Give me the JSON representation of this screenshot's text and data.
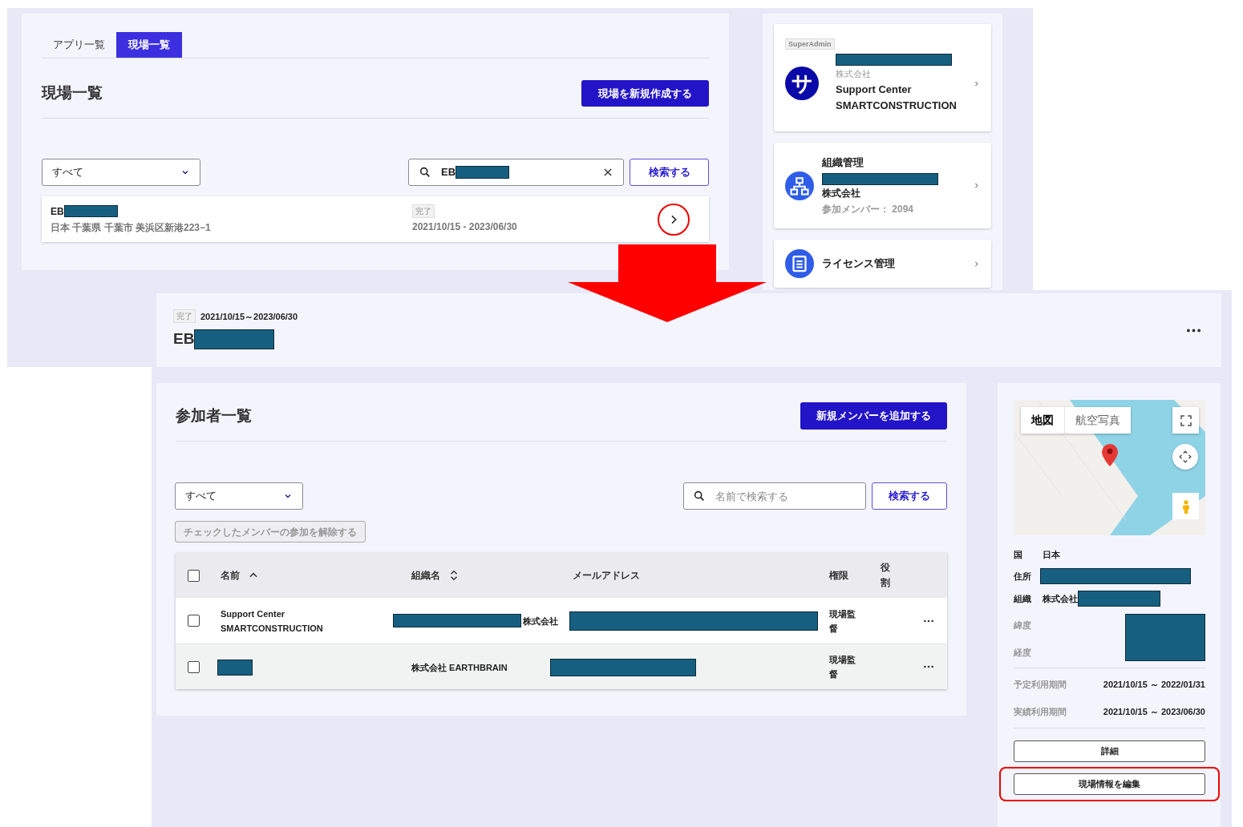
{
  "list_screen": {
    "tabs": [
      {
        "label": "アプリ一覧",
        "selected": false
      },
      {
        "label": "現場一覧",
        "selected": true
      }
    ],
    "title": "現場一覧",
    "create_button": "現場を新規作成する",
    "filter": {
      "value": "すべて"
    },
    "search": {
      "value": "EB"
    },
    "search_button": "検索する",
    "sites": [
      {
        "name": "EB",
        "address": "日本 千葉県 千葉市 美浜区新港223−1",
        "status": "完了",
        "period": "2021/10/15 - 2023/06/30",
        "highlighted": true
      }
    ]
  },
  "account_menu": {
    "badge": "SuperAdmin",
    "avatar": "サ",
    "company": "株式会社",
    "user": "Support Center SMARTCONSTRUCTION",
    "org_title": "組織管理",
    "org_company": "株式会社",
    "member_count": "参加メンバー： 2094",
    "license": "ライセンス管理"
  },
  "detail_screen": {
    "status": "完了",
    "period": "2021/10/15～2023/06/30",
    "title": "EB",
    "members": {
      "title": "参加者一覧",
      "add_button": "新規メンバーを追加する",
      "filter": {
        "value": "すべて"
      },
      "search": {
        "placeholder": "名前で検索する"
      },
      "search_button": "検索する",
      "remove_button": {
        "label": "チェックしたメンバーの参加を解除する",
        "disabled": true
      },
      "table": {
        "select_all": {
          "checked": false
        },
        "columns": [
          {
            "label": "名前",
            "sortable": true,
            "sorted": true
          },
          {
            "label": "組織名",
            "sortable": true,
            "sorted": false
          },
          {
            "label": "メールアドレス",
            "sortable": false
          },
          {
            "label": "権限",
            "sortable": false
          },
          {
            "label": "役割",
            "sortable": false
          }
        ],
        "rows": [
          {
            "checked": false,
            "highlighted": false,
            "name": "Support Center SMARTCONSTRUCTION",
            "org_masked": true,
            "organization": "株式会社",
            "permission": "現場監督"
          },
          {
            "checked": false,
            "highlighted": true,
            "org_masked": false,
            "organization": "株式会社 EARTHBRAIN",
            "permission": "現場監督"
          }
        ]
      }
    },
    "site_info": {
      "map_types": [
        {
          "label": "地図",
          "selected": true
        },
        {
          "label": "航空写真",
          "selected": false
        }
      ],
      "fields": [
        {
          "label": "国",
          "value": "日本"
        },
        {
          "label": "住所"
        },
        {
          "label": "組織",
          "value": "株式会社"
        }
      ],
      "coordinates": [
        "緯度",
        "経度"
      ],
      "periods": [
        {
          "label": "予定利用期間",
          "value": "2021/10/15 ～ 2022/01/31"
        },
        {
          "label": "実績利用期間",
          "value": "2021/10/15 ～ 2023/06/30"
        }
      ],
      "buttons": [
        {
          "label": "詳細",
          "highlighted": false
        },
        {
          "label": "現場情報を編集",
          "highlighted": true
        }
      ]
    }
  }
}
